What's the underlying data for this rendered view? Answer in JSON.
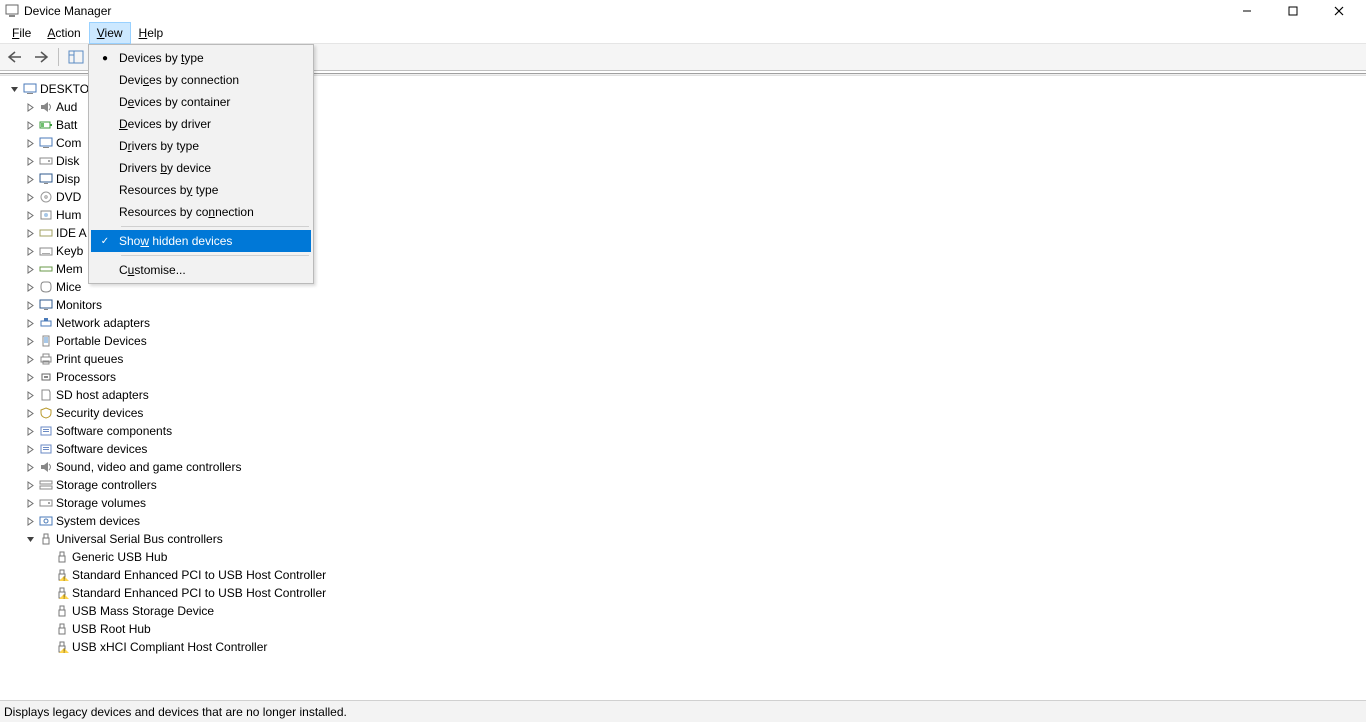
{
  "window": {
    "title": "Device Manager"
  },
  "menubar": {
    "file": "File",
    "file_m": "F",
    "action": "Action",
    "action_m": "A",
    "view": "View",
    "view_m": "V",
    "help": "Help",
    "help_m": "H"
  },
  "view_menu": {
    "items": [
      {
        "label": "Devices by type",
        "bullet": true,
        "mn": "t"
      },
      {
        "label": "Devices by connection",
        "bullet": false,
        "mn": "c"
      },
      {
        "label": "Devices by container",
        "bullet": false,
        "mn": "e"
      },
      {
        "label": "Devices by driver",
        "bullet": false,
        "mn": "d"
      },
      {
        "label": "Drivers by type",
        "bullet": false,
        "mn": "r"
      },
      {
        "label": "Drivers by device",
        "bullet": false,
        "mn": "b"
      },
      {
        "label": "Resources by type",
        "bullet": false,
        "mn": "y"
      },
      {
        "label": "Resources by connection",
        "bullet": false,
        "mn": "n"
      }
    ],
    "show_hidden": {
      "label": "Show hidden devices",
      "checked": true,
      "mn": "w"
    },
    "customise": "Customise...",
    "customise_mn": "u"
  },
  "tree": {
    "root": "DESKTO",
    "categories": [
      {
        "label": "Aud",
        "icon": "audio"
      },
      {
        "label": "Batt",
        "icon": "battery"
      },
      {
        "label": "Com",
        "icon": "computer"
      },
      {
        "label": "Disk",
        "icon": "disk"
      },
      {
        "label": "Disp",
        "icon": "display"
      },
      {
        "label": "DVD",
        "icon": "dvd"
      },
      {
        "label": "Hum",
        "icon": "hid"
      },
      {
        "label": "IDE A",
        "icon": "ide"
      },
      {
        "label": "Keyb",
        "icon": "keyboard"
      },
      {
        "label": "Mem",
        "icon": "memory"
      },
      {
        "label": "Mice",
        "icon": "mouse"
      },
      {
        "label": "Monitors",
        "icon": "monitor"
      },
      {
        "label": "Network adapters",
        "icon": "network"
      },
      {
        "label": "Portable Devices",
        "icon": "portable"
      },
      {
        "label": "Print queues",
        "icon": "printer"
      },
      {
        "label": "Processors",
        "icon": "cpu"
      },
      {
        "label": "SD host adapters",
        "icon": "sd"
      },
      {
        "label": "Security devices",
        "icon": "security"
      },
      {
        "label": "Software components",
        "icon": "software"
      },
      {
        "label": "Software devices",
        "icon": "software"
      },
      {
        "label": "Sound, video and game controllers",
        "icon": "sound"
      },
      {
        "label": "Storage controllers",
        "icon": "storage"
      },
      {
        "label": "Storage volumes",
        "icon": "volume"
      },
      {
        "label": "System devices",
        "icon": "system"
      }
    ],
    "usb": {
      "label": "Universal Serial Bus controllers",
      "children": [
        {
          "label": "Generic USB Hub",
          "warn": false
        },
        {
          "label": "Standard Enhanced PCI to USB Host Controller",
          "warn": true
        },
        {
          "label": "Standard Enhanced PCI to USB Host Controller",
          "warn": true
        },
        {
          "label": "USB Mass Storage Device",
          "warn": false
        },
        {
          "label": "USB Root Hub",
          "warn": false
        },
        {
          "label": "USB xHCI Compliant Host Controller",
          "warn": true
        }
      ]
    }
  },
  "statusbar": "Displays legacy devices and devices that are no longer installed."
}
